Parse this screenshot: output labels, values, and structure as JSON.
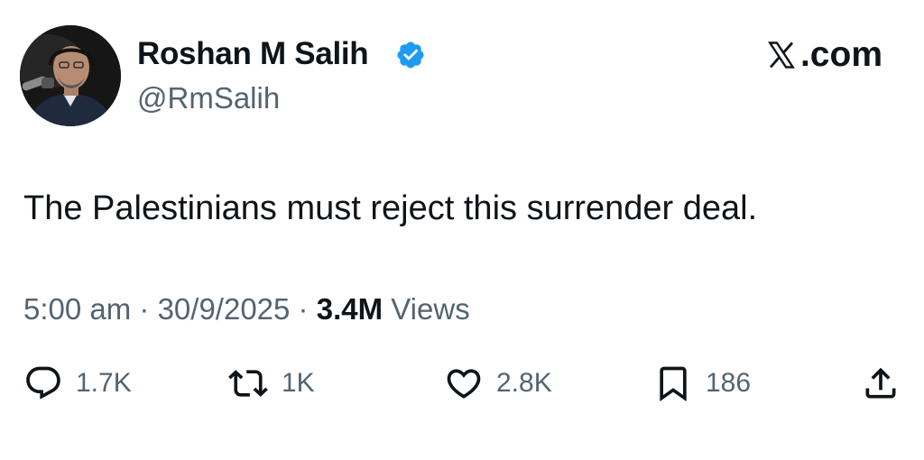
{
  "author": {
    "display_name": "Roshan M Salih",
    "handle": "@RmSalih",
    "verified": true
  },
  "site": {
    "logo_text": ".com",
    "logo_icon": "x-logo-icon"
  },
  "tweet": {
    "text": "The Palestinians must reject this surrender deal.",
    "time": "5:00 am",
    "separator": " · ",
    "date": "30/9/2025",
    "views_count": "3.4M",
    "views_label": " Views"
  },
  "actions": {
    "replies": "1.7K",
    "reposts": "1K",
    "likes": "2.8K",
    "bookmarks": "186"
  },
  "colors": {
    "text": "#0f1419",
    "secondary": "#536471",
    "verified_badge": "#1d9bf0",
    "background": "#ffffff"
  }
}
